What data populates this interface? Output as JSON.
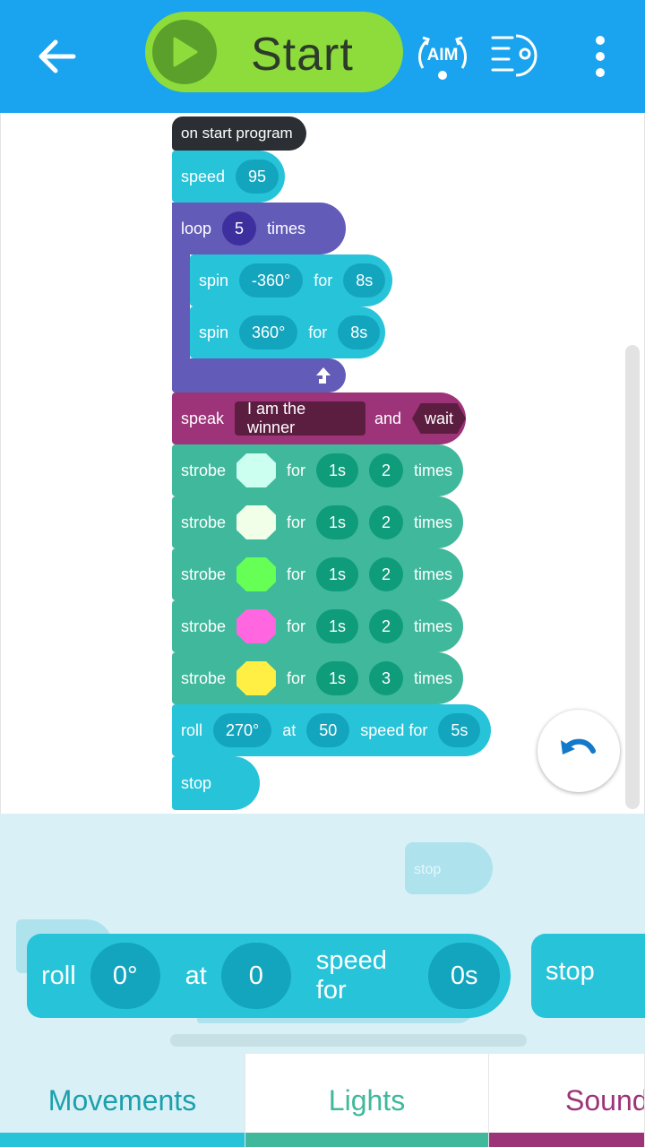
{
  "header": {
    "start_label": "Start",
    "aim_label": "AIM"
  },
  "program": {
    "hat_label": "on start program",
    "speed_block": {
      "word": "speed",
      "value": "95"
    },
    "loop_block": {
      "word": "loop",
      "count": "5",
      "suffix": "times"
    },
    "spin_blocks": [
      {
        "word": "spin",
        "angle": "-360°",
        "for": "for",
        "duration": "8s"
      },
      {
        "word": "spin",
        "angle": "360°",
        "for": "for",
        "duration": "8s"
      }
    ],
    "speak_block": {
      "word": "speak",
      "text": "I am the winner",
      "and": "and",
      "wait": "wait"
    },
    "strobe_blocks": [
      {
        "word": "strobe",
        "color": "#ccfff0",
        "for": "for",
        "duration": "1s",
        "count": "2",
        "suffix": "times"
      },
      {
        "word": "strobe",
        "color": "#f2ffe8",
        "for": "for",
        "duration": "1s",
        "count": "2",
        "suffix": "times"
      },
      {
        "word": "strobe",
        "color": "#66ff55",
        "for": "for",
        "duration": "1s",
        "count": "2",
        "suffix": "times"
      },
      {
        "word": "strobe",
        "color": "#ff66e0",
        "for": "for",
        "duration": "1s",
        "count": "2",
        "suffix": "times"
      },
      {
        "word": "strobe",
        "color": "#ffee44",
        "for": "for",
        "duration": "1s",
        "count": "3",
        "suffix": "times"
      }
    ],
    "roll_block": {
      "word": "roll",
      "heading": "270°",
      "at": "at",
      "speed": "50",
      "speed_for": "speed for",
      "duration": "5s"
    },
    "stop_block": {
      "word": "stop"
    }
  },
  "palette": {
    "ghost_stop": "stop",
    "roll": {
      "word": "roll",
      "heading": "0°",
      "at": "at",
      "speed": "0",
      "speed_for": "speed for",
      "duration": "0s"
    },
    "stop": "stop"
  },
  "tabs": [
    {
      "label": "Movements",
      "color": "#1ba0ac",
      "bar": "#27c3d9"
    },
    {
      "label": "Lights",
      "color": "#3fb89c",
      "bar": "#3fb89c"
    },
    {
      "label": "Sound",
      "color": "#9d3378",
      "bar": "#9d3378"
    }
  ]
}
